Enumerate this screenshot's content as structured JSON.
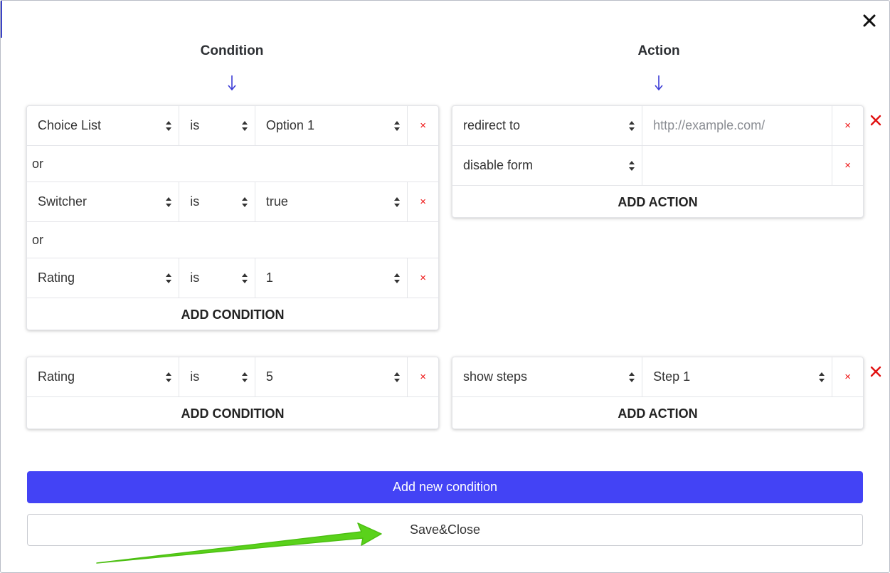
{
  "modal": {
    "condition_title": "Condition",
    "action_title": "Action",
    "arrow_glyph": "↓"
  },
  "rule1": {
    "conditions": [
      {
        "field": "Choice List",
        "operator": "is",
        "value": "Option 1"
      },
      {
        "field": "Switcher",
        "operator": "is",
        "value": "true"
      },
      {
        "field": "Rating",
        "operator": "is",
        "value": "1"
      }
    ],
    "or_label": "or",
    "add_condition": "ADD CONDITION",
    "actions": [
      {
        "type": "redirect to",
        "target_placeholder": "http://example.com/"
      },
      {
        "type": "disable form",
        "target": ""
      }
    ],
    "add_action": "ADD ACTION"
  },
  "rule2": {
    "conditions": [
      {
        "field": "Rating",
        "operator": "is",
        "value": "5"
      }
    ],
    "add_condition": "ADD CONDITION",
    "actions": [
      {
        "type": "show steps",
        "target": "Step 1"
      }
    ],
    "add_action": "ADD ACTION"
  },
  "buttons": {
    "add_new_condition": "Add new condition",
    "save_close": "Save&Close"
  },
  "delete_glyph": "×",
  "colors": {
    "primary": "#4343f5",
    "delete_red": "#e11111",
    "arrow_blue": "#3b3bd6",
    "annotation_green": "#5ad21b"
  },
  "icons": {
    "close": "close-icon",
    "delete": "delete-icon",
    "down_arrow": "arrow-down-icon",
    "select": "select-updown-icon"
  }
}
